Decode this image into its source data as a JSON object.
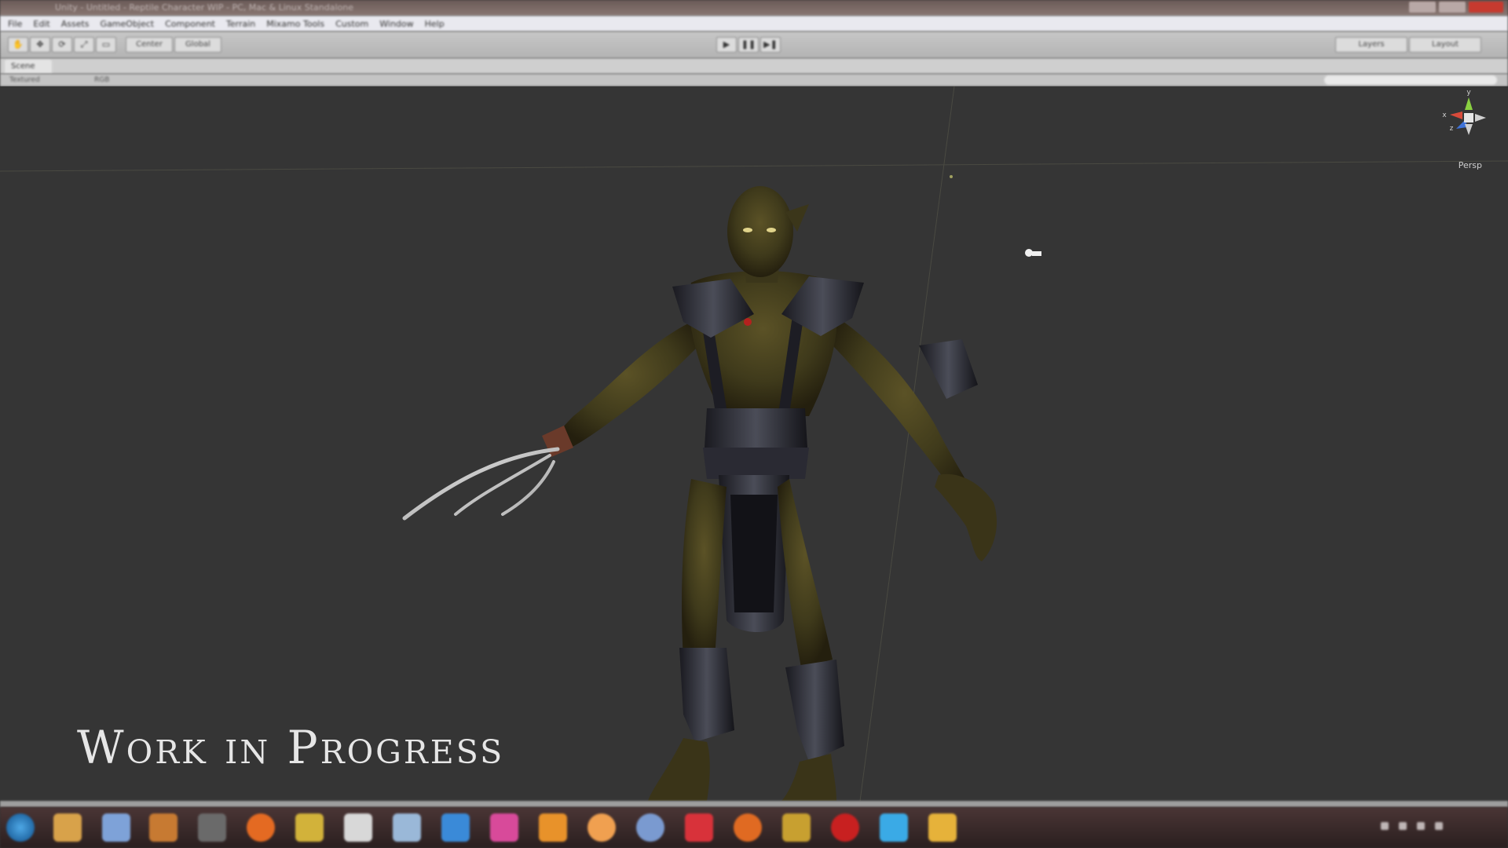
{
  "window": {
    "title": "Unity - Untitled - Reptile Character WIP - PC, Mac & Linux Standalone",
    "controls": [
      "minimize",
      "maximize",
      "close"
    ]
  },
  "menu": {
    "items": [
      "File",
      "Edit",
      "Assets",
      "GameObject",
      "Component",
      "Terrain",
      "Mixamo Tools",
      "Custom",
      "Window",
      "Help"
    ]
  },
  "toolbar": {
    "transform_tools": [
      "hand",
      "move",
      "rotate",
      "scale",
      "rect"
    ],
    "pivot_label": "Center",
    "space_label": "Global",
    "playback": [
      "play-icon",
      "pause-icon",
      "step-icon"
    ],
    "layers_label": "Layers",
    "layout_label": "Layout"
  },
  "scene": {
    "tab_label": "Scene",
    "shading_mode": "Textured",
    "render_mode": "RGB",
    "gizmo_view": "Persp",
    "gizmo_axes": [
      "y",
      "x",
      "z"
    ]
  },
  "overlay": {
    "caption": "Work in Progress"
  },
  "taskbar": {
    "apps": [
      "start-orb-icon",
      "folder-icon",
      "explorer-icon",
      "photoshop-icon",
      "media-icon",
      "firefox-icon",
      "3dsmax-icon",
      "document-icon",
      "control-panel-icon",
      "unity-icon",
      "media-player-icon",
      "sublime-icon",
      "firefox-icon",
      "chrome-icon",
      "acrobat-icon",
      "firefox-icon",
      "ai-icon",
      "opera-icon",
      "skype-icon",
      "paint-icon"
    ]
  },
  "colors": {
    "viewport": "#353535",
    "toolbar": "#c4c4c4",
    "titlebar": "#7a6a66",
    "taskbar": "#3a2b2b",
    "gizmo_x": "#d84a3a",
    "gizmo_y": "#8ad041",
    "gizmo_z": "#3f73d8"
  }
}
